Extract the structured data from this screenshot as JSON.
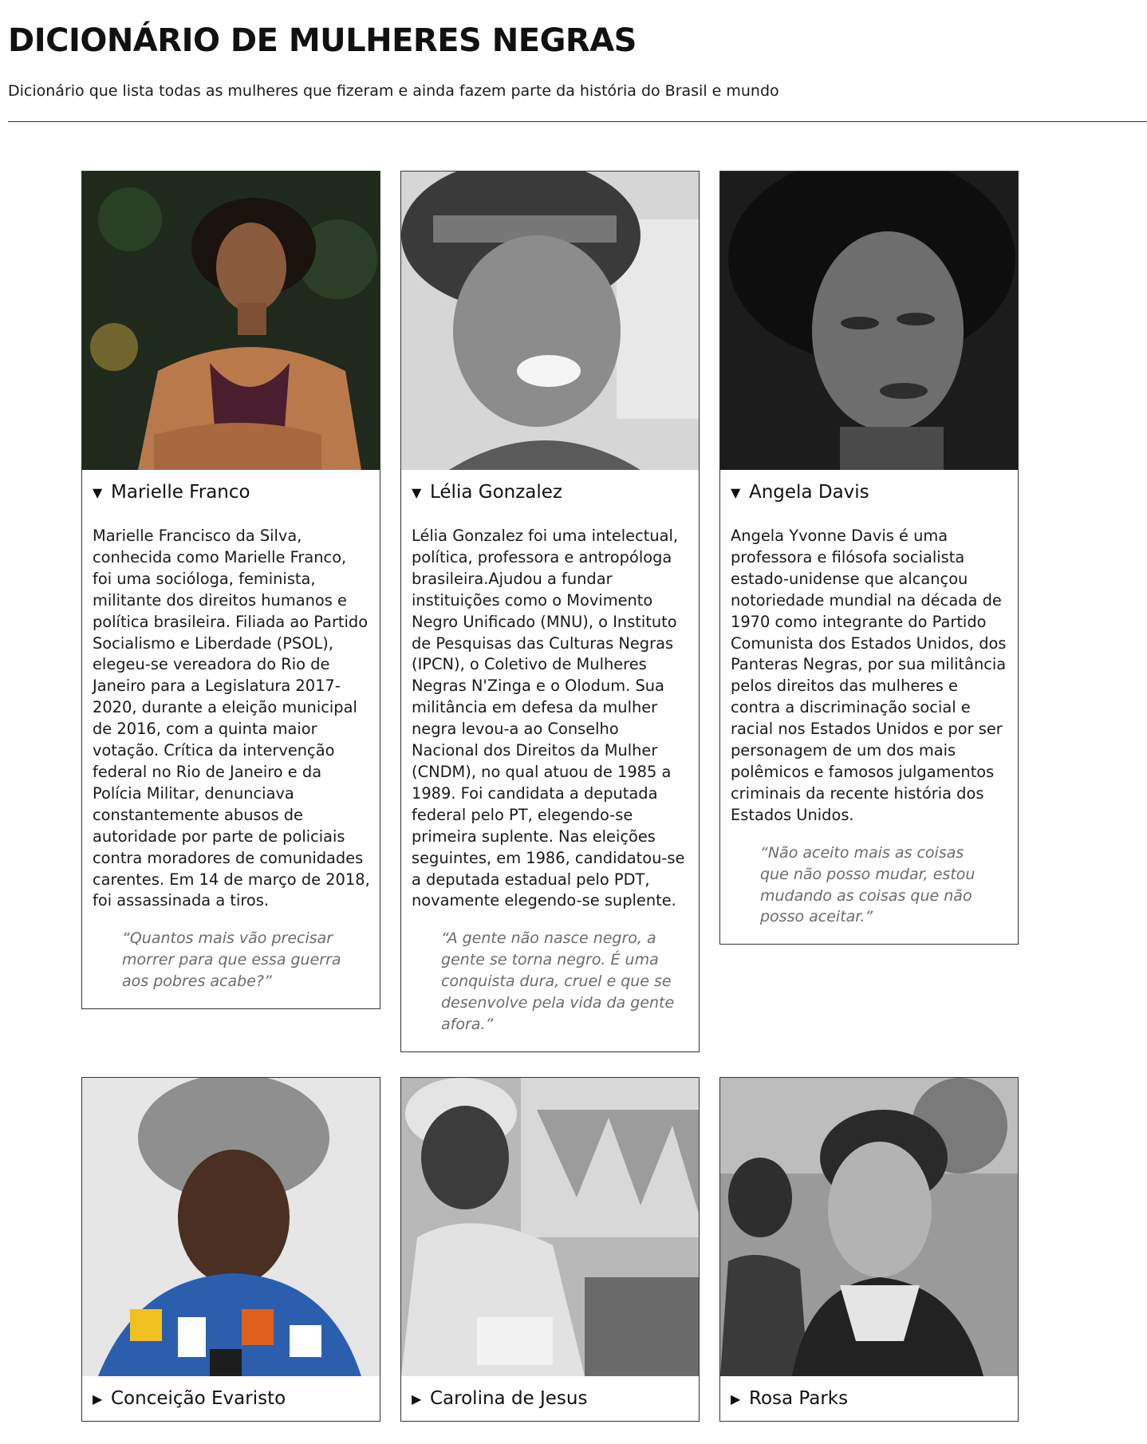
{
  "header": {
    "title": "DICIONÁRIO DE MULHERES NEGRAS",
    "subtitle": "Dicionário que lista todas as mulheres que fizeram e ainda fazem parte da história do Brasil e mundo"
  },
  "cards": [
    {
      "name": "Marielle Franco",
      "expanded": true,
      "marker": "▼",
      "bio": "Marielle Francisco da Silva, conhecida como Marielle Franco, foi uma socióloga, feminista, militante dos direitos humanos e política brasileira. Filiada ao Partido Socialismo e Liberdade (PSOL), elegeu-se vereadora do Rio de Janeiro para a Legislatura 2017-2020, durante a eleição municipal de 2016, com a quinta maior votação. Crítica da intervenção federal no Rio de Janeiro e da Polícia Militar, denunciava constantemente abusos de autoridade por parte de policiais contra moradores de comunidades carentes. Em 14 de março de 2018, foi assassinada a tiros.",
      "quote": "“Quantos mais vão precisar morrer para que essa guerra aos pobres acabe?”"
    },
    {
      "name": "Lélia Gonzalez",
      "expanded": true,
      "marker": "▼",
      "bio": "Lélia Gonzalez foi uma intelectual, política, professora e antropóloga brasileira.Ajudou a fundar instituições como o Movimento Negro Unificado (MNU), o Instituto de Pesquisas das Culturas Negras (IPCN), o Coletivo de Mulheres Negras N'Zinga e o Olodum. Sua militância em defesa da mulher negra levou-a ao Conselho Nacional dos Direitos da Mulher (CNDM), no qual atuou de 1985 a 1989. Foi candidata a deputada federal pelo PT, elegendo-se primeira suplente. Nas eleições seguintes, em 1986, candidatou-se a deputada estadual pelo PDT, novamente elegendo-se suplente.",
      "quote": "“A gente não nasce negro, a gente se torna negro. É uma conquista dura, cruel e que se desenvolve pela vida da gente afora.”"
    },
    {
      "name": "Angela Davis",
      "expanded": true,
      "marker": "▼",
      "bio": "Angela Yvonne Davis é uma professora e filósofa socialista estado-unidense que alcançou notoriedade mundial na década de 1970 como integrante do Partido Comunista dos Estados Unidos, dos Panteras Negras, por sua militância pelos direitos das mulheres e contra a discriminação social e racial nos Estados Unidos e por ser personagem de um dos mais polêmicos e famosos julgamentos criminais da recente história dos Estados Unidos.",
      "quote": "“Não aceito mais as coisas que não posso mudar, estou mudando as coisas que não posso aceitar.”"
    },
    {
      "name": "Conceição Evaristo",
      "expanded": false,
      "marker": "▶",
      "bio": "",
      "quote": ""
    },
    {
      "name": "Carolina de Jesus",
      "expanded": false,
      "marker": "▶",
      "bio": "",
      "quote": ""
    },
    {
      "name": "Rosa Parks",
      "expanded": false,
      "marker": "▶",
      "bio": "",
      "quote": ""
    }
  ]
}
